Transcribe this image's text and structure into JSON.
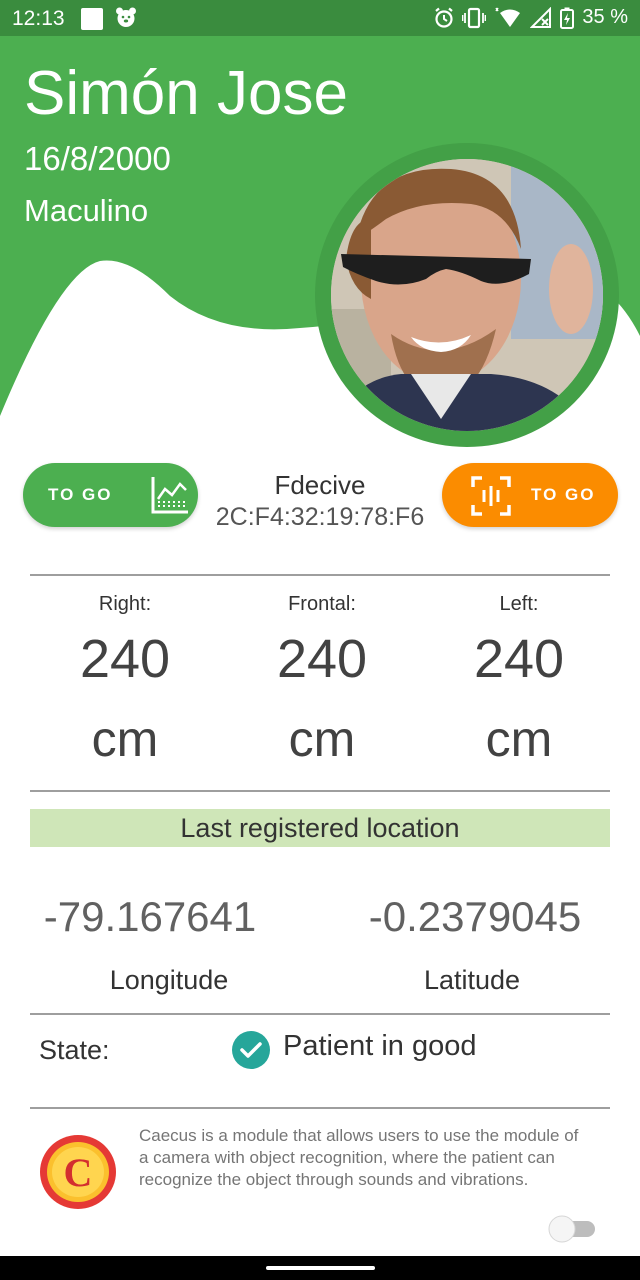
{
  "status_bar": {
    "time": "12:13",
    "battery": "35 %",
    "icons": [
      "notification-square-icon",
      "bear-app-icon",
      "alarm-icon",
      "vibrate-icon",
      "wifi-icon",
      "signal-icon",
      "battery-icon"
    ]
  },
  "patient": {
    "name": "Simón Jose",
    "birth_date": "16/8/2000",
    "gender": "Maculino"
  },
  "device": {
    "title": "Fdecive",
    "mac": "2C:F4:32:19:78:F6",
    "left_button_label": "TO GO",
    "right_button_label": "TO GO"
  },
  "distances": [
    {
      "label": "Right:",
      "value": "240",
      "unit": "cm"
    },
    {
      "label": "Frontal:",
      "value": "240",
      "unit": "cm"
    },
    {
      "label": "Left:",
      "value": "240",
      "unit": "cm"
    }
  ],
  "location": {
    "banner": "Last registered location",
    "longitude_value": "-79.167641",
    "longitude_label": "Longitude",
    "latitude_value": "-0.2379045",
    "latitude_label": "Latitude"
  },
  "state": {
    "label": "State:",
    "value": "Patient in good"
  },
  "module": {
    "logo_letter": "C",
    "description": "Caecus is a module that allows users to use the module of a camera with object recognition, where the patient can recognize the object through sounds and vibrations.",
    "toggle_on": false
  },
  "colors": {
    "header_green": "#4caf50",
    "status_green": "#3a8c3e",
    "orange": "#fb8c00",
    "banner_green": "#cfe6b8",
    "check_teal": "#26a69a"
  }
}
